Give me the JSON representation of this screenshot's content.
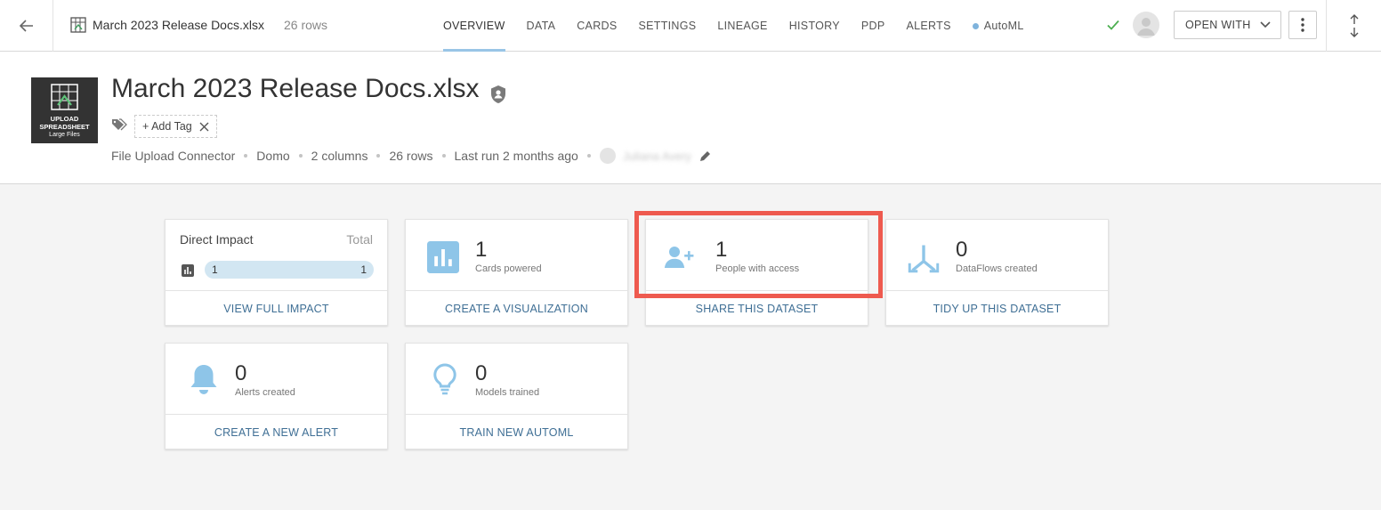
{
  "topbar": {
    "dataset_name": "March 2023 Release Docs.xlsx",
    "rows_label": "26 rows",
    "tabs": [
      {
        "label": "OVERVIEW",
        "active": true
      },
      {
        "label": "DATA"
      },
      {
        "label": "CARDS"
      },
      {
        "label": "SETTINGS"
      },
      {
        "label": "LINEAGE"
      },
      {
        "label": "HISTORY"
      },
      {
        "label": "PDP"
      },
      {
        "label": "ALERTS"
      },
      {
        "label": "AutoML"
      }
    ],
    "open_with_label": "OPEN WITH"
  },
  "header": {
    "title": "March 2023 Release Docs.xlsx",
    "thumb_line1": "UPLOAD",
    "thumb_line2": "SPREADSHEET",
    "thumb_line3": "Large Files",
    "add_tag_label": "+ Add Tag",
    "meta": {
      "connector": "File Upload Connector",
      "owner_org": "Domo",
      "columns": "2 columns",
      "rows": "26 rows",
      "last_run": "Last run 2 months ago",
      "owner_name": "Juliana Avery"
    }
  },
  "cards": {
    "impact": {
      "title": "Direct Impact",
      "total_label": "Total",
      "bar_left": "1",
      "bar_right": "1",
      "action": "VIEW FULL IMPACT"
    },
    "cards_powered": {
      "value": "1",
      "label": "Cards powered",
      "action": "CREATE A VISUALIZATION"
    },
    "people": {
      "value": "1",
      "label": "People with access",
      "action": "SHARE THIS DATASET"
    },
    "dataflows": {
      "value": "0",
      "label": "DataFlows created",
      "action": "TIDY UP THIS DATASET"
    },
    "alerts": {
      "value": "0",
      "label": "Alerts created",
      "action": "CREATE A NEW ALERT"
    },
    "models": {
      "value": "0",
      "label": "Models trained",
      "action": "TRAIN NEW AUTOML"
    }
  },
  "colors": {
    "accent": "#99c5e6",
    "icon_blue": "#8ec5e8",
    "link": "#3f6f95",
    "highlight": "#ee5a4f",
    "success": "#4caf50"
  }
}
